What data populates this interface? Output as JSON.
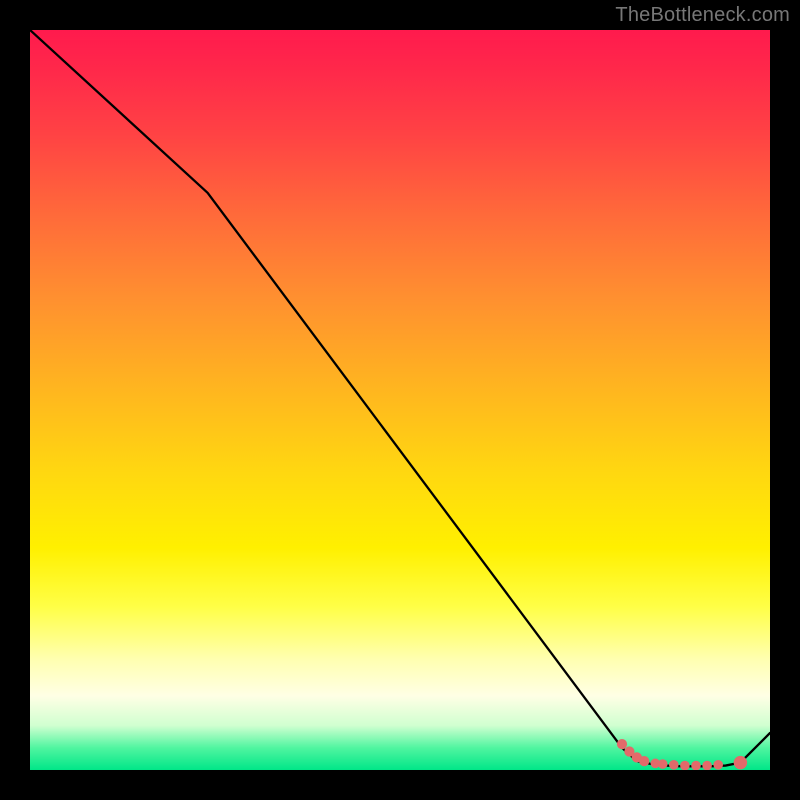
{
  "watermark": "TheBottleneck.com",
  "chart_data": {
    "type": "line",
    "title": "",
    "xlabel": "",
    "ylabel": "",
    "xlim": [
      0,
      100
    ],
    "ylim": [
      0,
      100
    ],
    "series": [
      {
        "name": "bottleneck-curve",
        "color": "#000000",
        "x": [
          0,
          24,
          80,
          82,
          84,
          86,
          88,
          90,
          92,
          94,
          96,
          100
        ],
        "y": [
          100,
          78,
          3,
          1.2,
          0.8,
          0.6,
          0.5,
          0.5,
          0.5,
          0.6,
          1.0,
          5
        ]
      }
    ],
    "markers": {
      "name": "highlight-points",
      "color": "#e26a6a",
      "points": [
        {
          "x": 80,
          "y": 3.5,
          "r": 3.2
        },
        {
          "x": 81,
          "y": 2.5,
          "r": 3.2
        },
        {
          "x": 82,
          "y": 1.7,
          "r": 3.2
        },
        {
          "x": 83,
          "y": 1.2,
          "r": 3.2
        },
        {
          "x": 84.5,
          "y": 0.9,
          "r": 3.0
        },
        {
          "x": 85.5,
          "y": 0.8,
          "r": 3.0
        },
        {
          "x": 87,
          "y": 0.7,
          "r": 3.0
        },
        {
          "x": 88.5,
          "y": 0.6,
          "r": 3.0
        },
        {
          "x": 90,
          "y": 0.6,
          "r": 3.0
        },
        {
          "x": 91.5,
          "y": 0.6,
          "r": 3.0
        },
        {
          "x": 93,
          "y": 0.7,
          "r": 3.0
        },
        {
          "x": 96,
          "y": 1.0,
          "r": 4.2
        }
      ]
    }
  }
}
